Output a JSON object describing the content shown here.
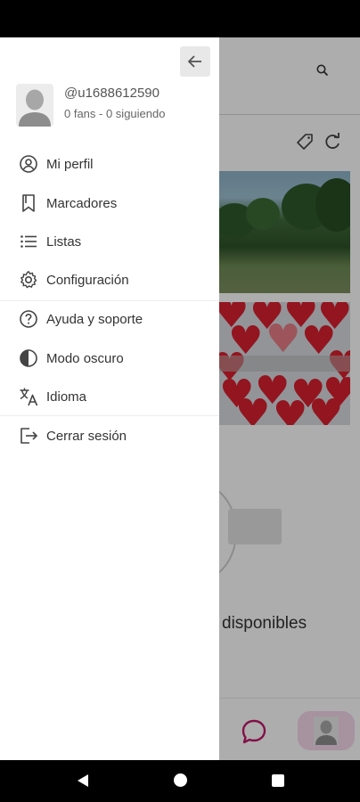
{
  "background": {
    "empty_text": "disponibles",
    "accent_color": "#c2186b"
  },
  "drawer": {
    "profile": {
      "username": "@u1688612590",
      "stats": "0 fans - 0 siguiendo"
    },
    "menu": [
      {
        "label": "Mi perfil",
        "icon": "account-circle-icon"
      },
      {
        "label": "Marcadores",
        "icon": "bookmark-icon"
      },
      {
        "label": "Listas",
        "icon": "list-icon"
      },
      {
        "label": "Configuración",
        "icon": "gear-icon"
      },
      {
        "label": "Ayuda y soporte",
        "icon": "help-circle-icon"
      },
      {
        "label": "Modo oscuro",
        "icon": "contrast-icon"
      },
      {
        "label": "Idioma",
        "icon": "translate-icon"
      },
      {
        "label": "Cerrar sesión",
        "icon": "logout-icon"
      }
    ]
  }
}
